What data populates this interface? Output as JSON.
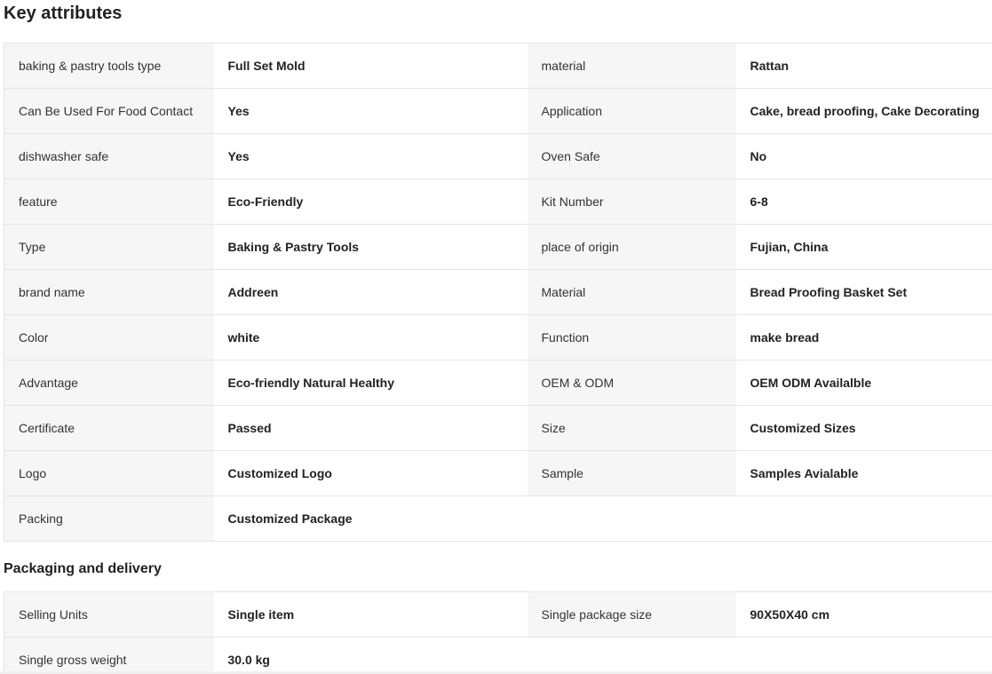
{
  "key_attributes": {
    "title": "Key attributes",
    "rows": [
      {
        "k1": "baking & pastry tools type",
        "v1": "Full Set Mold",
        "k2": "material",
        "v2": "Rattan"
      },
      {
        "k1": "Can Be Used For Food Contact",
        "v1": "Yes",
        "k2": "Application",
        "v2": "Cake, bread proofing, Cake Decorating"
      },
      {
        "k1": "dishwasher safe",
        "v1": "Yes",
        "k2": "Oven Safe",
        "v2": "No"
      },
      {
        "k1": "feature",
        "v1": "Eco-Friendly",
        "k2": "Kit Number",
        "v2": "6-8"
      },
      {
        "k1": "Type",
        "v1": "Baking & Pastry Tools",
        "k2": "place of origin",
        "v2": "Fujian, China"
      },
      {
        "k1": "brand name",
        "v1": "Addreen",
        "k2": "Material",
        "v2": "Bread Proofing Basket Set"
      },
      {
        "k1": "Color",
        "v1": "white",
        "k2": "Function",
        "v2": "make bread"
      },
      {
        "k1": "Advantage",
        "v1": "Eco-friendly Natural Healthy",
        "k2": "OEM & ODM",
        "v2": "OEM ODM Availalble"
      },
      {
        "k1": "Certificate",
        "v1": "Passed",
        "k2": "Size",
        "v2": "Customized Sizes"
      },
      {
        "k1": "Logo",
        "v1": "Customized Logo",
        "k2": "Sample",
        "v2": "Samples Avialable"
      },
      {
        "k1": "Packing",
        "v1": "Customized Package",
        "k2": "",
        "v2": ""
      }
    ]
  },
  "packaging": {
    "title": "Packaging and delivery",
    "rows": [
      {
        "k1": "Selling Units",
        "v1": "Single item",
        "k2": "Single package size",
        "v2": "90X50X40 cm"
      },
      {
        "k1": "Single gross weight",
        "v1": "30.0 kg",
        "k2": "",
        "v2": ""
      }
    ]
  }
}
